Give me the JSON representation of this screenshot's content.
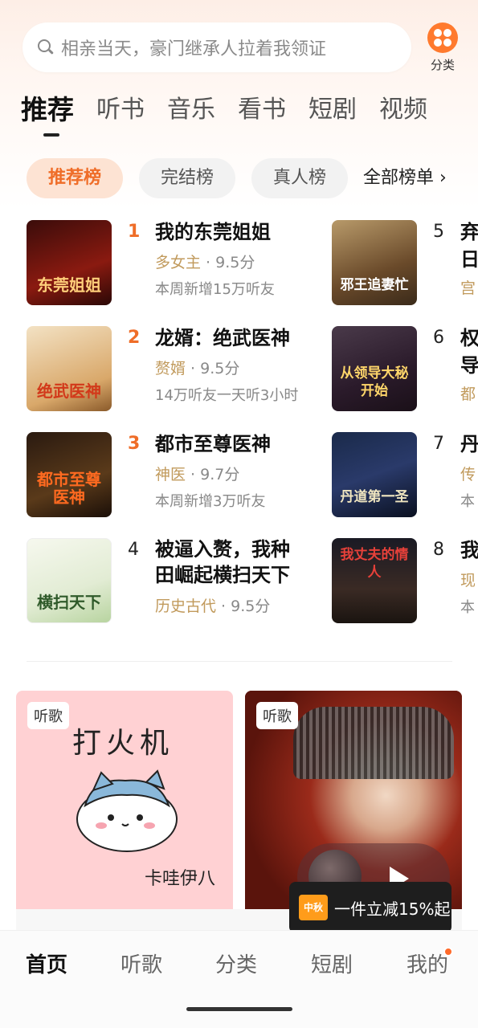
{
  "search": {
    "placeholder": "相亲当天，豪门继承人拉着我领证"
  },
  "category": {
    "label": "分类",
    "accent": "#ff7a2e"
  },
  "main_tabs": [
    "推荐",
    "听书",
    "音乐",
    "看书",
    "短剧",
    "视频"
  ],
  "chips": [
    "推荐榜",
    "完结榜",
    "真人榜"
  ],
  "all_rank": "全部榜单 ›",
  "ranks": [
    {
      "num": "1",
      "cover_text": "东莞姐姐",
      "title": "我的东莞姐姐",
      "genre": "多女主",
      "score": " · 9.5分",
      "sub": "本周新增15万听友"
    },
    {
      "num": "2",
      "cover_text": "绝武医神",
      "title": "龙婿：绝武医神",
      "genre": "赘婿",
      "score": " · 9.5分",
      "sub": "14万听友一天听3小时"
    },
    {
      "num": "3",
      "cover_text": "都市至尊医神",
      "title": "都市至尊医神",
      "genre": "神医",
      "score": " · 9.7分",
      "sub": "本周新增3万听友"
    },
    {
      "num": "4",
      "cover_text": "横扫天下",
      "title": "被逼入赘，我种田崛起横扫天下",
      "genre": "历史古代",
      "score": " · 9.5分",
      "sub": ""
    },
    {
      "num": "5",
      "cover_text": "邪王追妻忙",
      "title": "弃",
      "line2": "日",
      "genre": "宫",
      "score": "",
      "sub": ""
    },
    {
      "num": "6",
      "cover_text": "从领导大秘开始",
      "title": "权",
      "line2": "导",
      "genre": "都",
      "score": "",
      "sub": ""
    },
    {
      "num": "7",
      "cover_text": "丹道第一圣",
      "title": "丹",
      "genre": "传",
      "score": "",
      "sub": "本"
    },
    {
      "num": "8",
      "cover_text": "我丈夫的情人",
      "title": "我",
      "genre": "现",
      "score": "",
      "sub": "本"
    }
  ],
  "cards": [
    {
      "tag": "听歌",
      "title": "打火机",
      "author": "卡哇伊八"
    },
    {
      "tag": "听歌"
    }
  ],
  "promo": {
    "badge": "中秋",
    "text": "一件立减15%起"
  },
  "bottom_nav": [
    "首页",
    "听歌",
    "分类",
    "短剧",
    "我的"
  ]
}
